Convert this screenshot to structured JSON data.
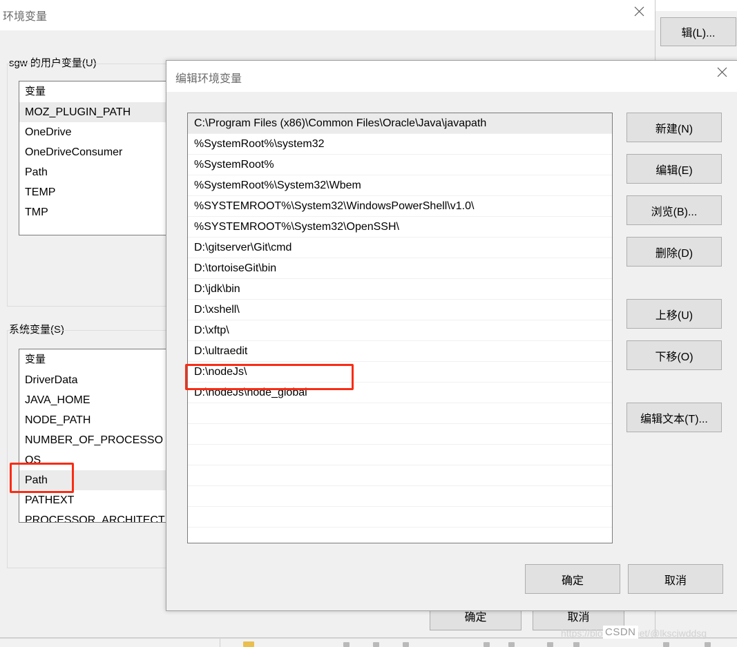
{
  "background_window": {
    "title": "环境变量",
    "close_icon": "close-icon",
    "user_vars": {
      "group_label": "sgw 的用户变量(U)",
      "column_header": "变量",
      "items": [
        {
          "name": "MOZ_PLUGIN_PATH",
          "selected": true
        },
        {
          "name": "OneDrive",
          "selected": false
        },
        {
          "name": "OneDriveConsumer",
          "selected": false
        },
        {
          "name": "Path",
          "selected": false
        },
        {
          "name": "TEMP",
          "selected": false
        },
        {
          "name": "TMP",
          "selected": false
        }
      ]
    },
    "system_vars": {
      "group_label": "系统变量(S)",
      "column_header": "变量",
      "items": [
        {
          "name": "DriverData",
          "selected": false
        },
        {
          "name": "JAVA_HOME",
          "selected": false
        },
        {
          "name": "NODE_PATH",
          "selected": false
        },
        {
          "name": "NUMBER_OF_PROCESSO",
          "selected": false
        },
        {
          "name": "OS",
          "selected": false
        },
        {
          "name": "Path",
          "selected": true,
          "annotated": true
        },
        {
          "name": "PATHEXT",
          "selected": false
        },
        {
          "name": "PROCESSOR_ARCHITECT",
          "selected": false
        }
      ]
    },
    "edit_button_clipped": "辑(L)...",
    "ok_button": "确定",
    "cancel_button": "取消"
  },
  "edit_dialog": {
    "title": "编辑环境变量",
    "close_icon": "close-icon",
    "path_entries": [
      {
        "value": "C:\\Program Files (x86)\\Common Files\\Oracle\\Java\\javapath",
        "selected": true,
        "annotated": false
      },
      {
        "value": "%SystemRoot%\\system32",
        "selected": false,
        "annotated": false
      },
      {
        "value": "%SystemRoot%",
        "selected": false,
        "annotated": false
      },
      {
        "value": "%SystemRoot%\\System32\\Wbem",
        "selected": false,
        "annotated": false
      },
      {
        "value": "%SYSTEMROOT%\\System32\\WindowsPowerShell\\v1.0\\",
        "selected": false,
        "annotated": false
      },
      {
        "value": "%SYSTEMROOT%\\System32\\OpenSSH\\",
        "selected": false,
        "annotated": false
      },
      {
        "value": "D:\\gitserver\\Git\\cmd",
        "selected": false,
        "annotated": false
      },
      {
        "value": "D:\\tortoiseGit\\bin",
        "selected": false,
        "annotated": false
      },
      {
        "value": "D:\\jdk\\bin",
        "selected": false,
        "annotated": false
      },
      {
        "value": "D:\\xshell\\",
        "selected": false,
        "annotated": false
      },
      {
        "value": "D:\\xftp\\",
        "selected": false,
        "annotated": false
      },
      {
        "value": "D:\\ultraedit",
        "selected": false,
        "annotated": false
      },
      {
        "value": "D:\\nodeJs\\",
        "selected": false,
        "annotated": false
      },
      {
        "value": "D:\\nodeJs\\node_global",
        "selected": false,
        "annotated": true
      }
    ],
    "empty_row_count": 8,
    "side_buttons": [
      {
        "label": "新建(N)",
        "accel": "N"
      },
      {
        "label": "编辑(E)",
        "accel": "E"
      },
      {
        "label": "浏览(B)...",
        "accel": "B"
      },
      {
        "label": "删除(D)",
        "accel": "D"
      },
      {
        "label": "上移(U)",
        "accel": "U"
      },
      {
        "label": "下移(O)",
        "accel": "O"
      },
      {
        "label": "编辑文本(T)...",
        "accel": "T"
      }
    ],
    "ok_button": "确定",
    "cancel_button": "取消"
  },
  "annotations": {
    "highlight_color": "#f92c14"
  },
  "watermark": {
    "url_text": "https://blog.csdn.net/@lkscjwddsg",
    "badge_text": "CSDN"
  }
}
